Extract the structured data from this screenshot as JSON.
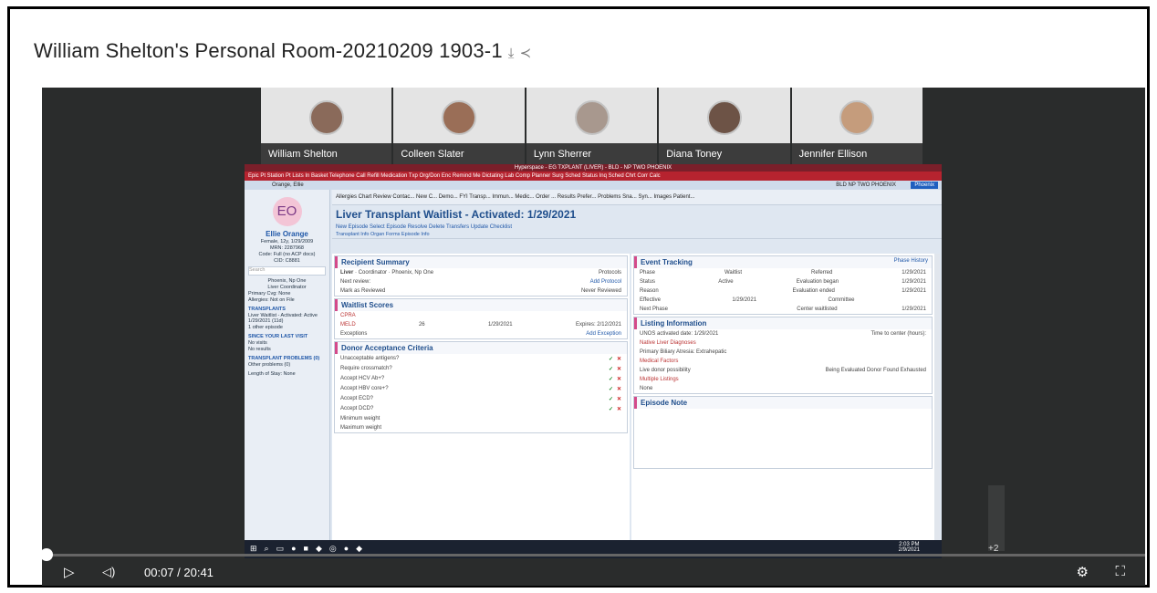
{
  "page": {
    "title": "William Shelton's Personal Room-20210209 1903-1",
    "download_icon": "⤓",
    "share_icon": "≺"
  },
  "participants": [
    {
      "name": "William Shelton"
    },
    {
      "name": "Colleen Slater"
    },
    {
      "name": "Lynn Sherrer"
    },
    {
      "name": "Diana Toney"
    },
    {
      "name": "Jennifer Ellison"
    }
  ],
  "extra_participants": "+2",
  "epic": {
    "window_title": "Hyperspace - EG TXPLANT (LIVER) - BLD - NP TWO PHOENIX",
    "toolbar": "Epic   Pt Station   Pt Lists   In Basket   Telephone Call   Refill Medication   Txp Org/Don Enc   Remind Me   Dictating   Lab Comp   Planner   Surg Sched   Status Inq   Sched   Chrt Corr   Calc",
    "patient_tab": "Orange, Ellie",
    "location": "BLD   NP TWO PHOENIX",
    "location_badge": "Phoenix",
    "patient": {
      "initials": "EO",
      "name": "Ellie Orange",
      "demo": "Female, 12y, 1/29/2009",
      "mrn": "MRN: 2287968",
      "code": "Code: Full (no ACP docs)",
      "csn": "CID: C8881",
      "search": "Search",
      "coordinator_name": "Phoenix, Np One",
      "coordinator_role": "Liver Coordinator",
      "coverage": "Primary Cvg: None",
      "allergies": "Allergies: Not on File",
      "transplants_heading": "TRANSPLANTS",
      "transplant_status": "Liver Waitlist - Activated: Active 1/29/2021 (11d)",
      "other_episode": "1 other episode",
      "since_heading": "SINCE YOUR LAST VISIT",
      "since_visits": "No visits",
      "since_results": "No results",
      "problems_heading": "TRANSPLANT PROBLEMS (0)",
      "other_problems": "Other problems (0)",
      "los": "Length of Stay: None"
    },
    "activities": "Allergies   Chart Review   Contac...   New C...   Demo...   FYI   Transp...   Immun...   Medic...   Order ...   Results   Prefer...   Problems   Sna...   Syn...   Images   Patient...",
    "episode_title": "Liver Transplant Waitlist - Activated: 1/29/2021",
    "episode_toolbar": "New Episode   Select Episode   Resolve   Delete   Transfers   Update Checklist",
    "subtabs": "Transplant Info   Organ   Forms   Episode Info",
    "recipient": {
      "heading": "Recipient Summary",
      "organ": "Liver",
      "role": "Coordinator",
      "person": "Phoenix, Np One",
      "protocols": "Protocols",
      "add_protocol": "Add Protocol",
      "next_review": "Next review:",
      "mark_reviewed": "Mark as Reviewed",
      "never_reviewed": "Never Reviewed"
    },
    "waitlist": {
      "heading": "Waitlist Scores",
      "cpra": "CPRA",
      "meld": "MELD",
      "meld_score": "26",
      "date": "1/29/2021",
      "expires": "Expires: 2/12/2021",
      "exceptions": "Exceptions",
      "add_exception": "Add Exception"
    },
    "donor": {
      "heading": "Donor Acceptance Criteria",
      "rows": [
        "Unacceptable antigens?",
        "Require crossmatch?",
        "Accept HCV Ab+?",
        "Accept HBV core+?",
        "Accept ECD?",
        "Accept DCD?",
        "Minimum weight",
        "Maximum weight"
      ]
    },
    "event": {
      "heading": "Event Tracking",
      "phase_history": "Phase History",
      "rows": [
        {
          "label": "Phase",
          "value": "Waitlist",
          "label2": "Referred",
          "value2": "1/29/2021"
        },
        {
          "label": "Status",
          "value": "Active",
          "label2": "Evaluation began",
          "value2": "1/29/2021"
        },
        {
          "label": "Reason",
          "value": "",
          "label2": "Evaluation ended",
          "value2": "1/29/2021"
        },
        {
          "label": "Effective",
          "value": "1/29/2021",
          "label2": "Committee",
          "value2": ""
        },
        {
          "label": "Next Phase",
          "value": "",
          "label2": "Center waitlisted",
          "value2": "1/29/2021"
        }
      ]
    },
    "listing": {
      "heading": "Listing Information",
      "unos": "UNOS activated date: 1/29/2021",
      "time_to_center": "Time to center (hours):",
      "diagnoses": "Native Liver Diagnoses",
      "primary": "Primary   Biliary Atresia: Extrahepatic",
      "medical": "Medical Factors",
      "live_donor": "Live donor possibility",
      "donor_options": "Being Evaluated   Donor Found   Exhausted",
      "multiple": "Multiple Listings",
      "none": "None"
    },
    "episode_note": {
      "heading": "Episode Note"
    },
    "clock_time": "2:03 PM",
    "clock_date": "2/9/2021"
  },
  "player": {
    "time": "00:07 / 20:41",
    "progress_fraction": 0.006
  }
}
